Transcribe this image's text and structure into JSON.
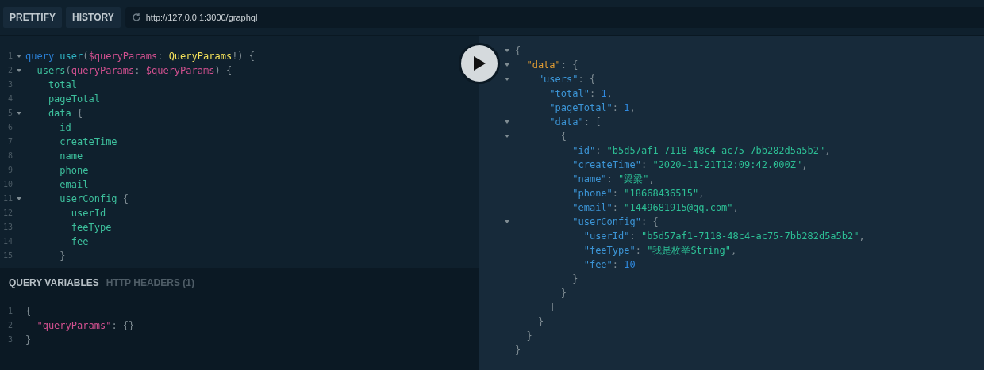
{
  "toolbar": {
    "buttons": [
      "PRETTIFY",
      "HISTORY"
    ],
    "endpoint": "http://127.0.0.1:3000/graphql"
  },
  "query_editor": {
    "lines": [
      {
        "number": "1",
        "foldable": true,
        "tokens": [
          {
            "text": "query",
            "kind": "keyword"
          },
          {
            "text": " user",
            "kind": "def"
          },
          {
            "text": "(",
            "kind": "punct"
          },
          {
            "text": "$queryParams",
            "kind": "variable"
          },
          {
            "text": ": ",
            "kind": "punct"
          },
          {
            "text": "QueryParams",
            "kind": "type"
          },
          {
            "text": "!) {",
            "kind": "punct"
          }
        ]
      },
      {
        "number": "2",
        "foldable": true,
        "tokens": [
          {
            "text": "  users",
            "kind": "property"
          },
          {
            "text": "(",
            "kind": "punct"
          },
          {
            "text": "queryParams",
            "kind": "variable"
          },
          {
            "text": ": ",
            "kind": "punct"
          },
          {
            "text": "$queryParams",
            "kind": "variable"
          },
          {
            "text": ") {",
            "kind": "punct"
          }
        ]
      },
      {
        "number": "3",
        "foldable": false,
        "tokens": [
          {
            "text": "    total",
            "kind": "property"
          }
        ]
      },
      {
        "number": "4",
        "foldable": false,
        "tokens": [
          {
            "text": "    pageTotal",
            "kind": "property"
          }
        ]
      },
      {
        "number": "5",
        "foldable": true,
        "tokens": [
          {
            "text": "    data",
            "kind": "property"
          },
          {
            "text": " {",
            "kind": "punct"
          }
        ]
      },
      {
        "number": "6",
        "foldable": false,
        "tokens": [
          {
            "text": "      id",
            "kind": "property"
          }
        ]
      },
      {
        "number": "7",
        "foldable": false,
        "tokens": [
          {
            "text": "      createTime",
            "kind": "property"
          }
        ]
      },
      {
        "number": "8",
        "foldable": false,
        "tokens": [
          {
            "text": "      name",
            "kind": "property"
          }
        ]
      },
      {
        "number": "9",
        "foldable": false,
        "tokens": [
          {
            "text": "      phone",
            "kind": "property"
          }
        ]
      },
      {
        "number": "10",
        "foldable": false,
        "tokens": [
          {
            "text": "      email",
            "kind": "property"
          }
        ]
      },
      {
        "number": "11",
        "foldable": true,
        "tokens": [
          {
            "text": "      userConfig",
            "kind": "property"
          },
          {
            "text": " {",
            "kind": "punct"
          }
        ]
      },
      {
        "number": "12",
        "foldable": false,
        "tokens": [
          {
            "text": "        userId",
            "kind": "property"
          }
        ]
      },
      {
        "number": "13",
        "foldable": false,
        "tokens": [
          {
            "text": "        feeType",
            "kind": "property"
          }
        ]
      },
      {
        "number": "14",
        "foldable": false,
        "tokens": [
          {
            "text": "        fee",
            "kind": "property"
          }
        ]
      },
      {
        "number": "15",
        "foldable": false,
        "tokens": [
          {
            "text": "      }",
            "kind": "punct"
          }
        ]
      }
    ]
  },
  "variables_panel": {
    "tabs": [
      {
        "label": "QUERY VARIABLES",
        "selected": true
      },
      {
        "label": "HTTP HEADERS (1)",
        "selected": false
      }
    ],
    "lines": [
      {
        "number": "1",
        "tokens": [
          {
            "text": "{",
            "kind": "punct"
          }
        ]
      },
      {
        "number": "2",
        "tokens": [
          {
            "text": "  \"queryParams\"",
            "kind": "variable"
          },
          {
            "text": ": {}",
            "kind": "punct"
          }
        ]
      },
      {
        "number": "3",
        "tokens": [
          {
            "text": "}",
            "kind": "punct"
          }
        ]
      }
    ]
  },
  "result": {
    "lines": [
      {
        "foldable": true,
        "tokens": [
          {
            "text": "{",
            "kind": "punct"
          }
        ]
      },
      {
        "foldable": true,
        "tokens": [
          {
            "text": "  \"data\"",
            "kind": "top_key"
          },
          {
            "text": ": {",
            "kind": "punct"
          }
        ]
      },
      {
        "foldable": true,
        "tokens": [
          {
            "text": "    \"users\"",
            "kind": "key"
          },
          {
            "text": ": {",
            "kind": "punct"
          }
        ]
      },
      {
        "foldable": false,
        "tokens": [
          {
            "text": "      \"total\"",
            "kind": "key"
          },
          {
            "text": ": ",
            "kind": "punct"
          },
          {
            "text": "1",
            "kind": "number"
          },
          {
            "text": ",",
            "kind": "punct"
          }
        ]
      },
      {
        "foldable": false,
        "tokens": [
          {
            "text": "      \"pageTotal\"",
            "kind": "key"
          },
          {
            "text": ": ",
            "kind": "punct"
          },
          {
            "text": "1",
            "kind": "number"
          },
          {
            "text": ",",
            "kind": "punct"
          }
        ]
      },
      {
        "foldable": true,
        "tokens": [
          {
            "text": "      \"data\"",
            "kind": "key"
          },
          {
            "text": ": [",
            "kind": "punct"
          }
        ]
      },
      {
        "foldable": true,
        "tokens": [
          {
            "text": "        {",
            "kind": "punct"
          }
        ]
      },
      {
        "foldable": false,
        "tokens": [
          {
            "text": "          \"id\"",
            "kind": "key"
          },
          {
            "text": ": ",
            "kind": "punct"
          },
          {
            "text": "\"b5d57af1-7118-48c4-ac75-7bb282d5a5b2\"",
            "kind": "string"
          },
          {
            "text": ",",
            "kind": "punct"
          }
        ]
      },
      {
        "foldable": false,
        "tokens": [
          {
            "text": "          \"createTime\"",
            "kind": "key"
          },
          {
            "text": ": ",
            "kind": "punct"
          },
          {
            "text": "\"2020-11-21T12:09:42.000Z\"",
            "kind": "string"
          },
          {
            "text": ",",
            "kind": "punct"
          }
        ]
      },
      {
        "foldable": false,
        "tokens": [
          {
            "text": "          \"name\"",
            "kind": "key"
          },
          {
            "text": ": ",
            "kind": "punct"
          },
          {
            "text": "\"梁梁\"",
            "kind": "string"
          },
          {
            "text": ",",
            "kind": "punct"
          }
        ]
      },
      {
        "foldable": false,
        "tokens": [
          {
            "text": "          \"phone\"",
            "kind": "key"
          },
          {
            "text": ": ",
            "kind": "punct"
          },
          {
            "text": "\"18668436515\"",
            "kind": "string"
          },
          {
            "text": ",",
            "kind": "punct"
          }
        ]
      },
      {
        "foldable": false,
        "tokens": [
          {
            "text": "          \"email\"",
            "kind": "key"
          },
          {
            "text": ": ",
            "kind": "punct"
          },
          {
            "text": "\"1449681915@qq.com\"",
            "kind": "string"
          },
          {
            "text": ",",
            "kind": "punct"
          }
        ]
      },
      {
        "foldable": true,
        "tokens": [
          {
            "text": "          \"userConfig\"",
            "kind": "key"
          },
          {
            "text": ": {",
            "kind": "punct"
          }
        ]
      },
      {
        "foldable": false,
        "tokens": [
          {
            "text": "            \"userId\"",
            "kind": "key"
          },
          {
            "text": ": ",
            "kind": "punct"
          },
          {
            "text": "\"b5d57af1-7118-48c4-ac75-7bb282d5a5b2\"",
            "kind": "string"
          },
          {
            "text": ",",
            "kind": "punct"
          }
        ]
      },
      {
        "foldable": false,
        "tokens": [
          {
            "text": "            \"feeType\"",
            "kind": "key"
          },
          {
            "text": ": ",
            "kind": "punct"
          },
          {
            "text": "\"我是枚举String\"",
            "kind": "string"
          },
          {
            "text": ",",
            "kind": "punct"
          }
        ]
      },
      {
        "foldable": false,
        "tokens": [
          {
            "text": "            \"fee\"",
            "kind": "key"
          },
          {
            "text": ": ",
            "kind": "punct"
          },
          {
            "text": "10",
            "kind": "number"
          }
        ]
      },
      {
        "foldable": false,
        "tokens": [
          {
            "text": "          }",
            "kind": "punct"
          }
        ]
      },
      {
        "foldable": false,
        "tokens": [
          {
            "text": "        }",
            "kind": "punct"
          }
        ]
      },
      {
        "foldable": false,
        "tokens": [
          {
            "text": "      ]",
            "kind": "punct"
          }
        ]
      },
      {
        "foldable": false,
        "tokens": [
          {
            "text": "    }",
            "kind": "punct"
          }
        ]
      },
      {
        "foldable": false,
        "tokens": [
          {
            "text": "  }",
            "kind": "punct"
          }
        ]
      },
      {
        "foldable": false,
        "tokens": [
          {
            "text": "}",
            "kind": "punct"
          }
        ]
      }
    ]
  }
}
